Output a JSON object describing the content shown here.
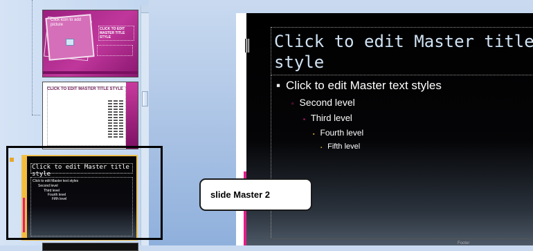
{
  "thumbnails": {
    "thumb1": {
      "caption": "Click icon to add picture",
      "title": "CLICK TO EDIT MASTER TITLE STYLE"
    },
    "thumb2": {
      "title": "CLICK TO EDIT MASTER TITLE STYLE"
    },
    "thumb3": {
      "title_line1": "Click to edit Master title",
      "title_line2": "style",
      "levels": [
        "Click to edit Master text styles",
        "Second level",
        "Third level",
        "Fourth level",
        "Fifth level"
      ]
    }
  },
  "slide": {
    "title": "Click to edit Master title style",
    "levels": [
      {
        "text": "Click to edit Master text styles",
        "bullet": "▪",
        "color": "#ffffff"
      },
      {
        "text": "Second level",
        "bullet": "▫",
        "color": "#e31d88"
      },
      {
        "text": "Third level",
        "bullet": "▪",
        "color": "#e31d88"
      },
      {
        "text": "Fourth level",
        "bullet": "▪",
        "color": "#f3bc3c"
      },
      {
        "text": "Fifth level",
        "bullet": "▪",
        "color": "#f3bc3c"
      }
    ],
    "footer": "Footer"
  },
  "callout": {
    "label": "slide Master 2"
  },
  "colors": {
    "title_text": "#cfe2f3",
    "accent_pink": "#e31d88",
    "accent_gold": "#f3bc3c"
  }
}
